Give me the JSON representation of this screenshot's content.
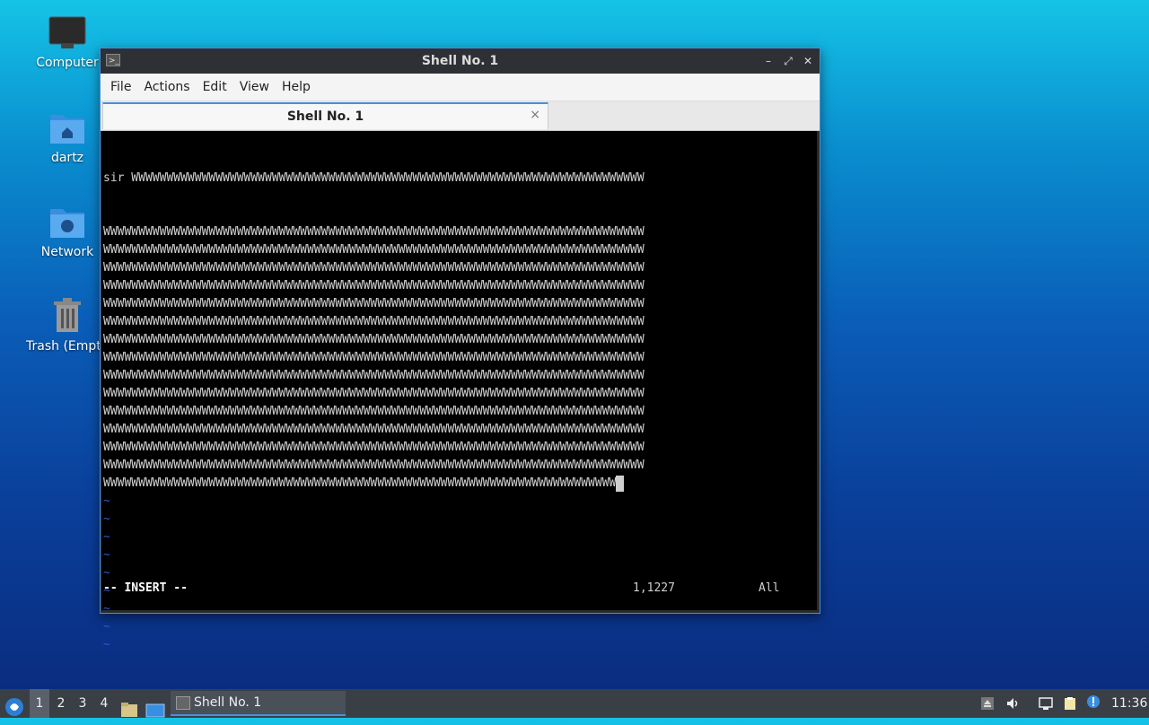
{
  "desktop": {
    "icons": [
      {
        "label": "Computer",
        "icon": "computer-icon"
      },
      {
        "label": "dartz",
        "icon": "home-folder-icon"
      },
      {
        "label": "Network",
        "icon": "network-folder-icon"
      },
      {
        "label": "Trash (Empty)",
        "icon": "trash-icon"
      }
    ]
  },
  "window": {
    "title": "Shell No. 1",
    "menu": [
      "File",
      "Actions",
      "Edit",
      "View",
      "Help"
    ],
    "tab": {
      "label": "Shell No. 1",
      "close": "×"
    },
    "buttons": {
      "minimize": "–",
      "maximize": "⤢",
      "close": "✕"
    }
  },
  "terminal": {
    "first_line": "sir WWWWWWWWWWWWWWWWWWWWWWWWWWWWWWWWWWWWWWWWWWWWWWWWWWWWWWWWWWWWWWWWWWWWWWWWW",
    "full_line": "WWWWWWWWWWWWWWWWWWWWWWWWWWWWWWWWWWWWWWWWWWWWWWWWWWWWWWWWWWWWWWWWWWWWWWWWWWWWW",
    "last_line": "WWWWWWWWWWWWWWWWWWWWWWWWWWWWWWWWWWWWWWWWWWWWWWWWWWWWWWWWWWWWWWWWWWWWWWWWW",
    "full_line_count": 14,
    "tilde_count": 9,
    "tilde": "~",
    "mode": "-- INSERT --",
    "position": "1,1227",
    "scroll": "All",
    "colors": {
      "tilde": "#2c5bd8",
      "text": "#cfcfcf",
      "background": "#000000"
    }
  },
  "taskbar": {
    "workspaces": [
      "1",
      "2",
      "3",
      "4"
    ],
    "active_workspace": "1",
    "task": "Shell No. 1",
    "clock": "11:36"
  }
}
